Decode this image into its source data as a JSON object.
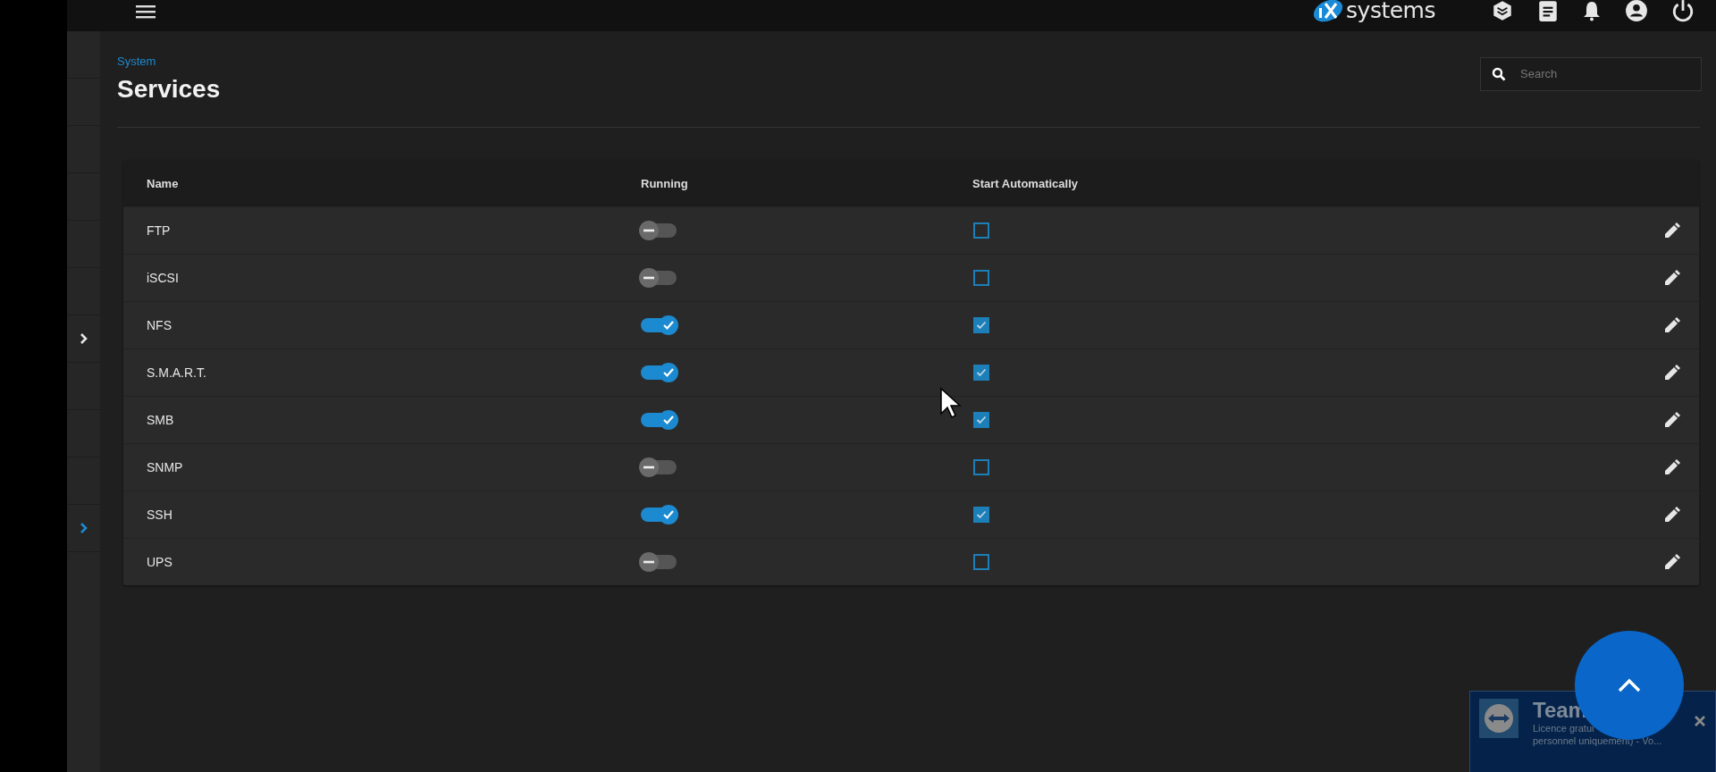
{
  "topbar": {
    "logo_text": "systems"
  },
  "sidebar": {
    "items": [
      {
        "expander": false
      },
      {
        "expander": false
      },
      {
        "expander": false
      },
      {
        "expander": false
      },
      {
        "expander": false
      },
      {
        "expander": false
      },
      {
        "expander": true,
        "color": "#e6e6e6"
      },
      {
        "expander": false
      },
      {
        "expander": false
      },
      {
        "expander": false
      },
      {
        "expander": true,
        "color": "#1c8ad0"
      }
    ]
  },
  "breadcrumb": "System",
  "title": "Services",
  "search": {
    "placeholder": "Search"
  },
  "table": {
    "columns": [
      "Name",
      "Running",
      "Start Automatically"
    ],
    "rows": [
      {
        "name": "FTP",
        "running": false,
        "start_automatically": false
      },
      {
        "name": "iSCSI",
        "running": false,
        "start_automatically": false
      },
      {
        "name": "NFS",
        "running": true,
        "start_automatically": true
      },
      {
        "name": "S.M.A.R.T.",
        "running": true,
        "start_automatically": true
      },
      {
        "name": "SMB",
        "running": true,
        "start_automatically": true
      },
      {
        "name": "SNMP",
        "running": false,
        "start_automatically": false
      },
      {
        "name": "SSH",
        "running": true,
        "start_automatically": true
      },
      {
        "name": "UPS",
        "running": false,
        "start_automatically": false
      }
    ]
  },
  "notification": {
    "title": "Team",
    "line_1": "Licence gratui",
    "line_2": "personnel uniquement) - Vo..."
  }
}
